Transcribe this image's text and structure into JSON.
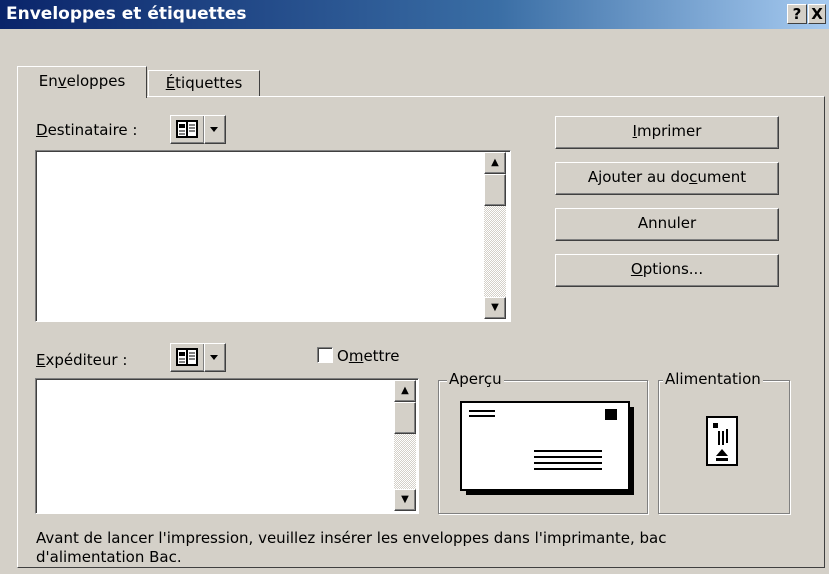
{
  "window": {
    "title": "Enveloppes et étiquettes",
    "help_glyph": "?",
    "close_glyph": "X"
  },
  "tabs": [
    {
      "pre": "En",
      "key": "v",
      "post": "eloppes"
    },
    {
      "pre": "",
      "key": "É",
      "post": "tiquettes"
    }
  ],
  "recipient": {
    "pre": "",
    "key": "D",
    "post": "estinataire :"
  },
  "sender": {
    "pre": "",
    "key": "E",
    "post": "xpéditeur :"
  },
  "omit": {
    "pre": "O",
    "key": "m",
    "post": "ettre",
    "checked": false
  },
  "buttons": {
    "print": {
      "pre": "",
      "key": "I",
      "post": "mprimer"
    },
    "add": {
      "pre": "Ajouter au do",
      "key": "c",
      "post": "ument"
    },
    "cancel": {
      "label": "Annuler"
    },
    "options": {
      "pre": "",
      "key": "O",
      "post": "ptions..."
    }
  },
  "preview_label": "Aperçu",
  "feed_label": "Alimentation",
  "status_line1": "Avant de lancer l'impression, veuillez insérer les enveloppes dans l'imprimante, bac",
  "status_line2": "d'alimentation Bac.",
  "icons": {
    "address_book": "address-book-icon",
    "dropdown": "dropdown-arrow-icon"
  }
}
